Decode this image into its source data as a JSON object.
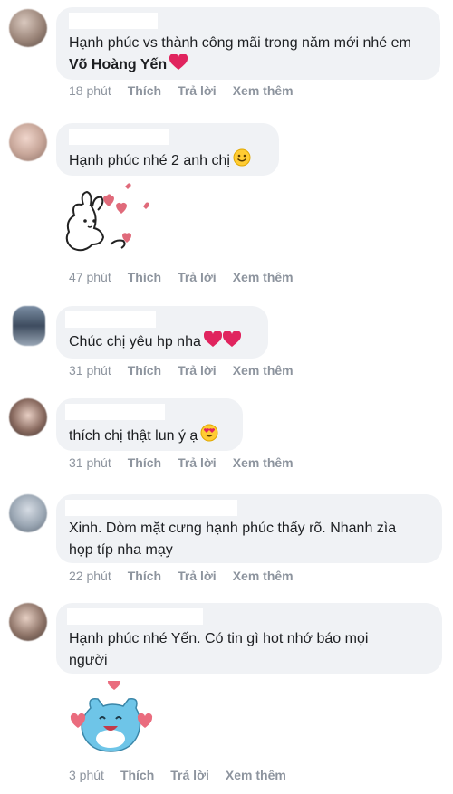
{
  "comments": [
    {
      "text_prefix": "Hạnh phúc vs thành công mãi trong năm mới nhé em ",
      "text_bold": "Võ Hoàng Yến",
      "time": "18 phút",
      "like": "Thích",
      "reply": "Trả lời",
      "more": "Xem thêm"
    },
    {
      "text": "Hạnh phúc nhé 2 anh chị",
      "time": "47 phút",
      "like": "Thích",
      "reply": "Trả lời",
      "more": "Xem thêm"
    },
    {
      "text": "Chúc chị yêu hp nha",
      "time": "31 phút",
      "like": "Thích",
      "reply": "Trả lời",
      "more": "Xem thêm"
    },
    {
      "text": "thích chị thật lun ý ạ",
      "time": "31 phút",
      "like": "Thích",
      "reply": "Trả lời",
      "more": "Xem thêm"
    },
    {
      "text_line1": "Xinh. Dòm mặt cưng hạnh phúc thấy rõ. Nhanh zìa",
      "text_line2": "họp típ nha mạy",
      "time": "22 phút",
      "like": "Thích",
      "reply": "Trả lời",
      "more": "Xem thêm"
    },
    {
      "text_line1": "Hạnh phúc nhé Yến. Có tin gì hot nhớ báo mọi",
      "text_line2": "người",
      "time": "3 phút",
      "like": "Thích",
      "reply": "Trả lời",
      "more": "Xem thêm"
    }
  ],
  "colors": {
    "bubble": "#f0f2f5",
    "meta": "#8d949e",
    "heart": "#e0245e"
  }
}
